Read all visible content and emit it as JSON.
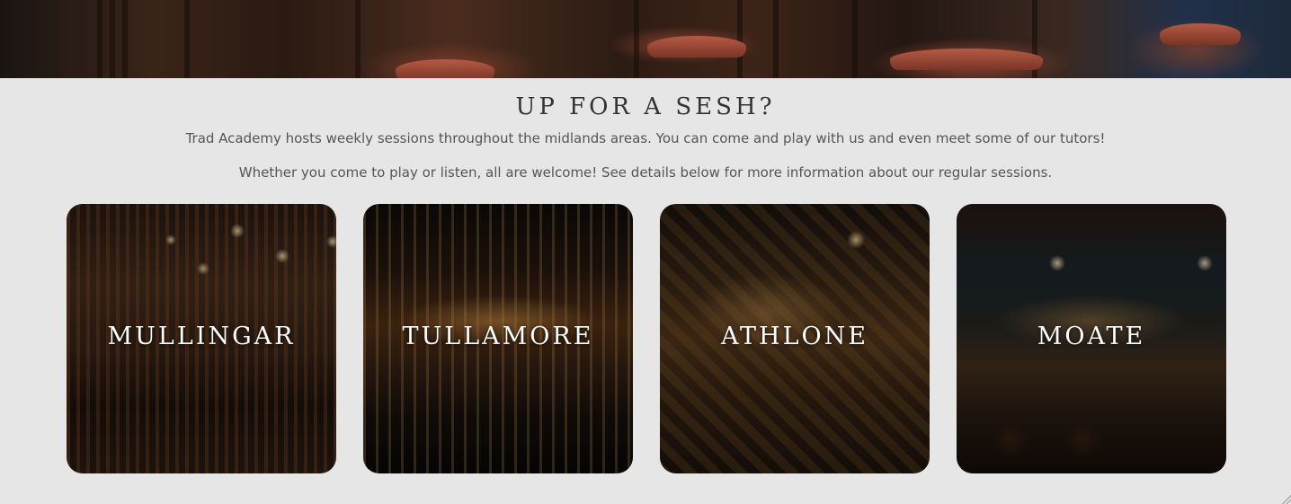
{
  "hero": {
    "image": "pub-chairs-photo"
  },
  "section": {
    "title": "UP FOR A SESH?",
    "intro": "Trad Academy hosts weekly sessions throughout the midlands areas. You can come and play with us and even meet some of our tutors!",
    "details": "Whether you come to play or listen, all are welcome! See details below for more information about our regular sessions."
  },
  "locations": [
    {
      "name": "MULLINGAR",
      "image": "pub-bar-photo"
    },
    {
      "name": "TULLAMORE",
      "image": "pub-bar-photo"
    },
    {
      "name": "ATHLONE",
      "image": "pub-bar-photo"
    },
    {
      "name": "MOATE",
      "image": "pub-bar-photo"
    }
  ],
  "colors": {
    "background": "#e6e6e6",
    "title": "#333333",
    "body_text": "#555555",
    "card_label": "#ffffff"
  }
}
